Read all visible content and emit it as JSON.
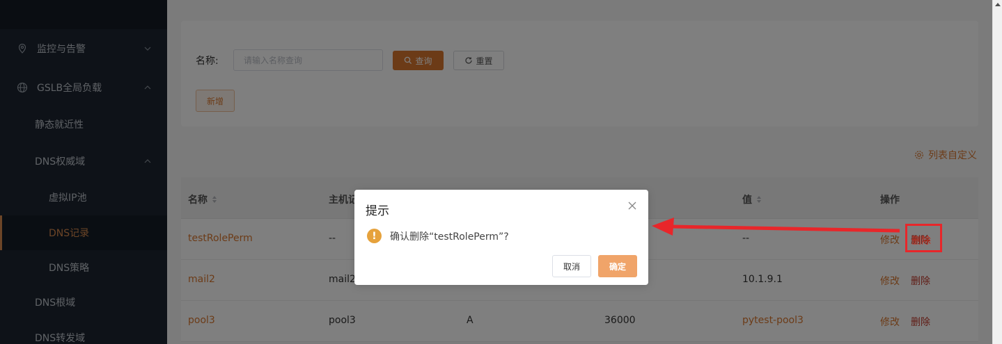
{
  "sidebar": {
    "items": [
      {
        "label": "监控与告警",
        "icon": "location-pin-icon",
        "caret": "down"
      },
      {
        "label": "GSLB全局负载",
        "icon": "globe-icon",
        "caret": "up"
      },
      {
        "label": "静态就近性"
      },
      {
        "label": "DNS权威域",
        "caret": "up"
      },
      {
        "label": "虚拟IP池"
      },
      {
        "label": "DNS记录",
        "active": true
      },
      {
        "label": "DNS策略"
      },
      {
        "label": "DNS根域"
      },
      {
        "label": "DNS转发域"
      }
    ]
  },
  "search": {
    "label": "名称:",
    "placeholder": "请输入名称查询",
    "query_label": "查询",
    "reset_label": "重置",
    "add_label": "新增"
  },
  "toolbar": {
    "column_custom_label": "列表自定义"
  },
  "table": {
    "headers": [
      "名称",
      "主机记",
      "",
      "",
      "值",
      "操作"
    ],
    "rows": [
      {
        "name": "testRolePerm",
        "host": "--",
        "type": "",
        "ttl": "",
        "value": "--",
        "edit": "修改",
        "delete": "删除"
      },
      {
        "name": "mail2",
        "host": "mail2",
        "type": "",
        "ttl": "",
        "value": "10.1.9.1",
        "edit": "修改",
        "delete": "删除"
      },
      {
        "name": "pool3",
        "host": "pool3",
        "type": "A",
        "ttl": "36000",
        "value": "pytest-pool3",
        "edit": "修改",
        "delete": "删除"
      }
    ]
  },
  "dialog": {
    "title": "提示",
    "message": "确认删除“testRolePerm”?",
    "cancel_label": "取消",
    "confirm_label": "确定",
    "warn_glyph": "!"
  },
  "annotation": {
    "highlight_label": "删除"
  },
  "colors": {
    "accent": "#d9772f",
    "danger": "#c0392b",
    "sidebar_bg": "#1d2531",
    "annotation_red": "#e8262a"
  }
}
